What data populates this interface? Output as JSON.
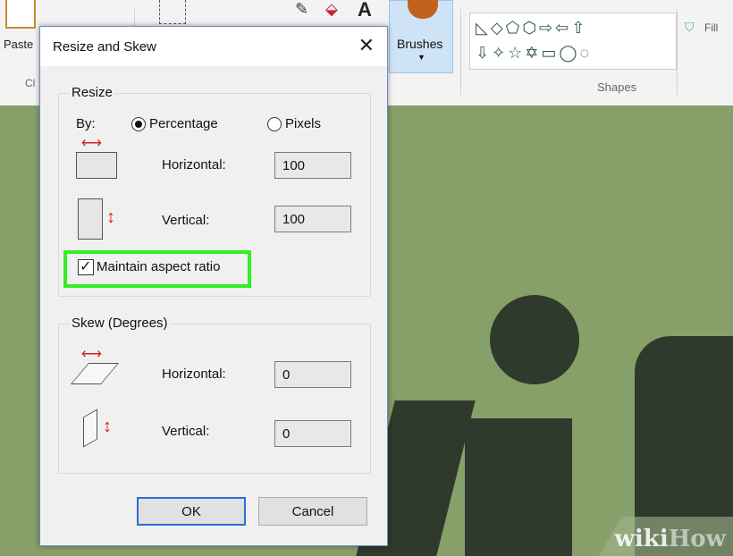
{
  "ribbon": {
    "paste_label": "Paste",
    "clipboard_group_partial": "Cl",
    "brushes_label": "Brushes",
    "shapes_group_label": "Shapes",
    "fill_label": "Fill",
    "text_tool_glyph": "A",
    "shapes_row1": "◺◇⬠⬡⇨⇦⇧",
    "shapes_row2": "⇩✧☆✡▭◯◌"
  },
  "dialog": {
    "title": "Resize and Skew",
    "close_glyph": "✕",
    "resize": {
      "group_label": "Resize",
      "by_label": "By:",
      "percentage_label": "Percentage",
      "pixels_label": "Pixels",
      "selected_mode": "Percentage",
      "horizontal_label": "Horizontal:",
      "horizontal_value": "100",
      "vertical_label": "Vertical:",
      "vertical_value": "100",
      "maintain_aspect_label": "Maintain aspect ratio",
      "maintain_aspect_checked": true
    },
    "skew": {
      "group_label": "Skew (Degrees)",
      "horizontal_label": "Horizontal:",
      "horizontal_value": "0",
      "vertical_label": "Vertical:",
      "vertical_value": "0"
    },
    "ok_label": "OK",
    "cancel_label": "Cancel"
  },
  "watermark": {
    "wiki": "wiki",
    "how": "How"
  },
  "colors": {
    "canvas": "#87a06a",
    "highlight": "#33ee22",
    "arrow": "#d61f1f",
    "default_button_border": "#2a6fd6"
  }
}
